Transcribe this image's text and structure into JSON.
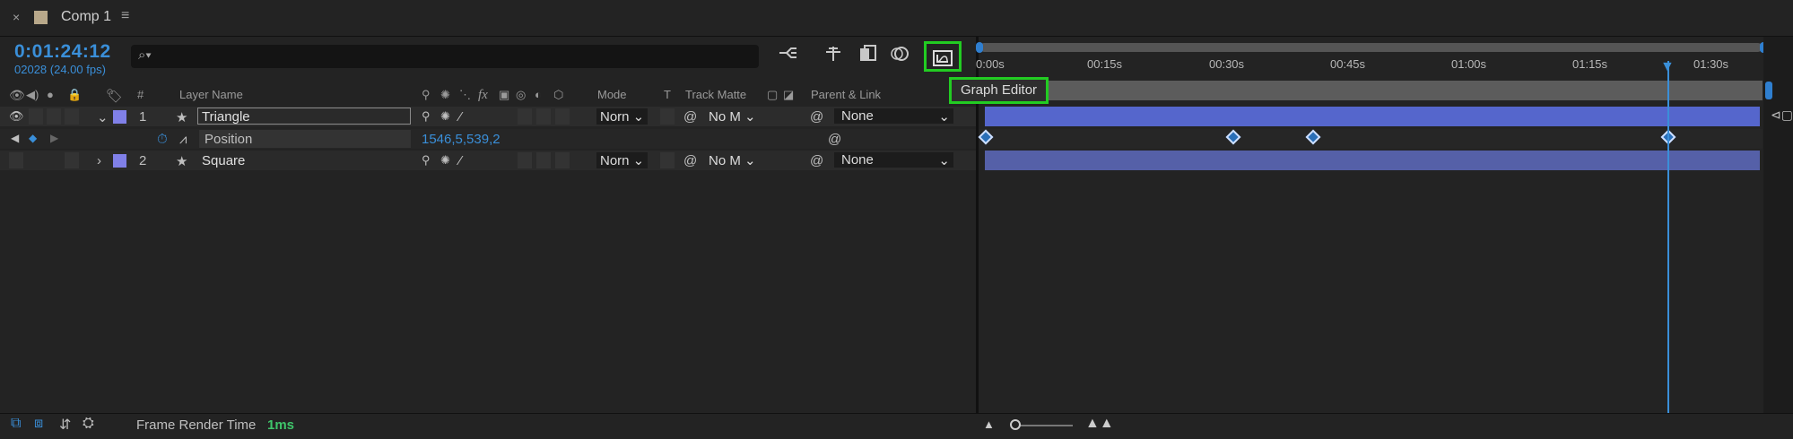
{
  "tab": {
    "title": "Comp 1",
    "close_glyph": "×",
    "menu_glyph": "≡",
    "swatch_color": "#b8a88a"
  },
  "time": {
    "timecode": "0:01:24:12",
    "frames": "02028 (24.00 fps)"
  },
  "search": {
    "icon": "search-icon",
    "placeholder": ""
  },
  "toolbar": {
    "tool_icons": [
      "flowchart-icon",
      "draft-3d-icon",
      "frame-blend-icon",
      "motion-blur-icon",
      "graph-editor-icon"
    ]
  },
  "tooltip": {
    "text": "Graph Editor"
  },
  "columns": {
    "layer_name": "Layer Name",
    "number": "#",
    "mode": "Mode",
    "t": "T",
    "track_matte": "Track Matte",
    "parent_link": "Parent & Link",
    "fx": "fx"
  },
  "layers": [
    {
      "number": "1",
      "name": "Triangle",
      "mode": "Norn",
      "matte": "No M",
      "parent": "None",
      "color": "#8080e8"
    },
    {
      "number": "2",
      "name": "Square",
      "mode": "Norn",
      "matte": "No M",
      "parent": "None",
      "color": "#8080e8"
    }
  ],
  "property": {
    "name": "Position",
    "value": "1546,5,539,2"
  },
  "ruler": {
    "ticks": [
      "0:00s",
      "00:15s",
      "00:30s",
      "00:45s",
      "01:00s",
      "01:15s",
      "01:30s"
    ]
  },
  "bottom": {
    "label": "Frame Render Time",
    "value": "1ms"
  },
  "colors": {
    "accent": "#3a8fd9",
    "highlight": "#22cc22",
    "layer_bar": "#5566cc",
    "render_time": "#3fc56a"
  }
}
